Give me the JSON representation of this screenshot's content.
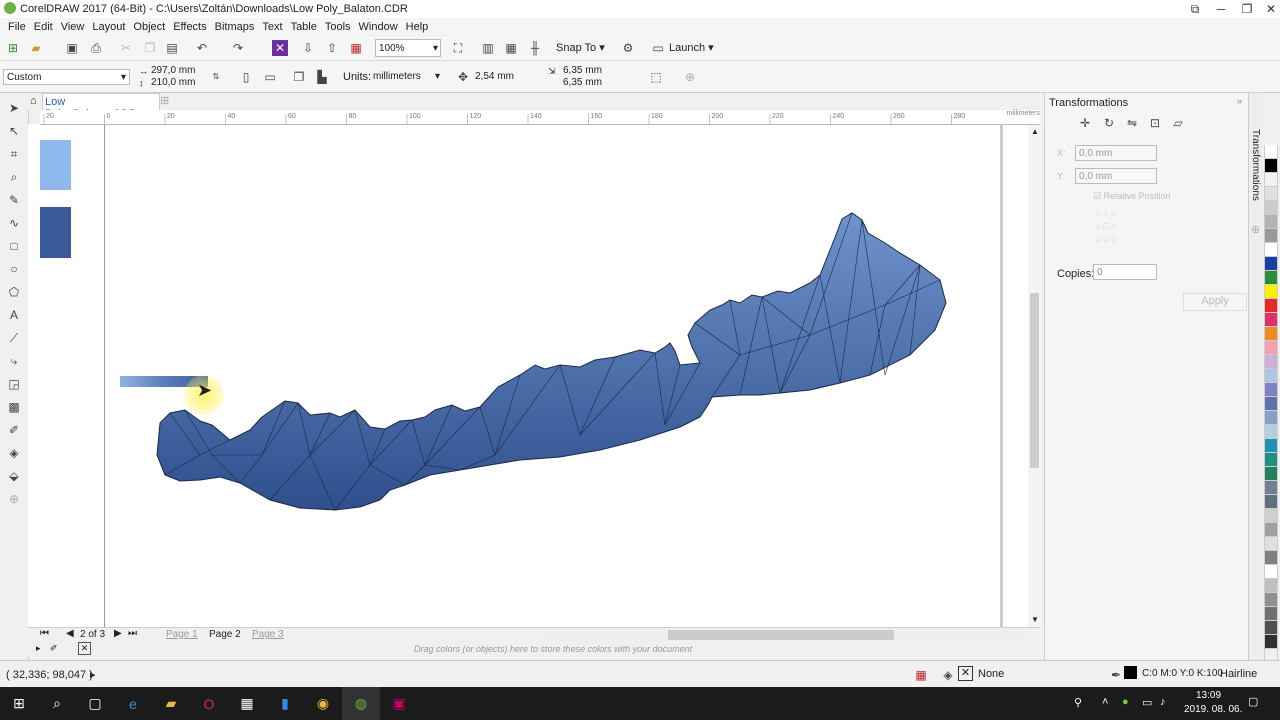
{
  "window": {
    "title": "CorelDRAW 2017 (64-Bit) - C:\\Users\\Zoltán\\Downloads\\Low Poly_Balaton.CDR"
  },
  "menu": [
    "File",
    "Edit",
    "View",
    "Layout",
    "Object",
    "Effects",
    "Bitmaps",
    "Text",
    "Table",
    "Tools",
    "Window",
    "Help"
  ],
  "toolbar": {
    "zoom": "100%",
    "snap_to": "Snap To",
    "launch": "Launch"
  },
  "property_bar": {
    "page_size": "Custom",
    "width": "297,0 mm",
    "height": "210,0 mm",
    "units_label": "Units:",
    "units_value": "millimeters",
    "nudge": "2,54 mm",
    "dup_x": "6,35 mm",
    "dup_y": "6,35 mm"
  },
  "document_tab": {
    "name": "Low Poly_Balaton.CDR"
  },
  "ruler": {
    "h_ticks": [
      "20",
      "0",
      "20",
      "40",
      "60",
      "80",
      "100",
      "120",
      "140",
      "160",
      "180",
      "200",
      "220",
      "240",
      "260",
      "280"
    ],
    "unit": "millimeters"
  },
  "page_nav": {
    "counter": "2 of 3",
    "pages": [
      "Page 1",
      "Page 2",
      "Page 3"
    ],
    "active": "Page 2"
  },
  "color_strip_hint": "Drag colors (or objects) here to store these colors with your document",
  "docker": {
    "title": "Transformations",
    "x": "0,0 mm",
    "y": "0,0 mm",
    "relative_position": "Relative Position",
    "copies_label": "Copies:",
    "copies_value": "0",
    "apply": "Apply",
    "tab_label": "Transformations"
  },
  "palette_colors": [
    "#ffffff",
    "#000000",
    "#f2f2f2",
    "#e0e0e0",
    "#cccccc",
    "#b3b3b3",
    "#999999",
    "#ffffff",
    "#1a3fa8",
    "#2a8e3a",
    "#ffef00",
    "#e62a2a",
    "#e0306a",
    "#f08a1c",
    "#f5a0b0",
    "#c8b0d8",
    "#b0c4e8",
    "#8080c8",
    "#6070b0",
    "#8aa0c8",
    "#b0d0e0",
    "#2090b0",
    "#209080",
    "#208060",
    "#708090",
    "#607080",
    "#d0d0d0",
    "#a0a0a0",
    "#e0e0e0",
    "#808080",
    "#ffffff",
    "#c0c0c0",
    "#909090",
    "#707070",
    "#505050",
    "#303030",
    "#f0f0f0"
  ],
  "swatches": [
    "#8fb8ec",
    "#3a5a9a"
  ],
  "status": {
    "coords": "( 32,336; 98,047 )",
    "fill_label": "None",
    "outline_label": "C:0 M:0 Y:0 K:100",
    "outline_width": "Hairline"
  },
  "taskbar": {
    "time": "13:09",
    "date": "2019. 08. 06."
  },
  "colors": {
    "shape_fill": "#4a6ea8",
    "shape_fill_dark": "#2f4f8c",
    "shape_stroke": "#1a2a44"
  }
}
